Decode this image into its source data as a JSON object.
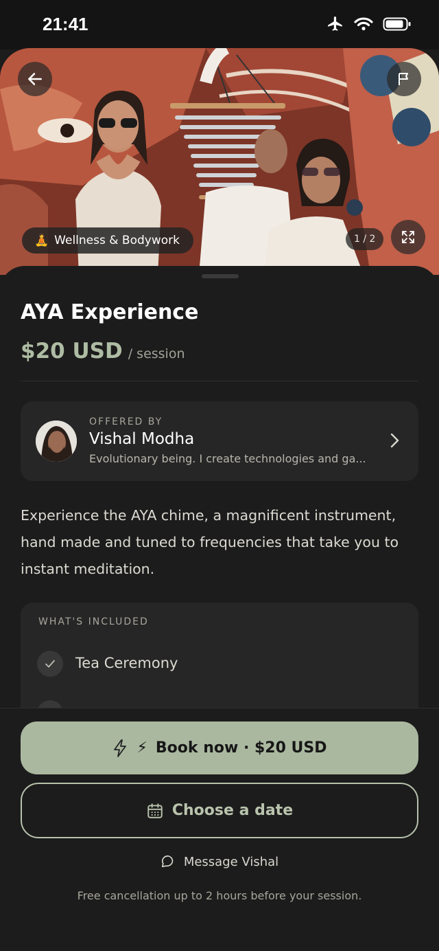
{
  "status_bar": {
    "time": "21:41",
    "icons": [
      "airplane-icon",
      "wifi-icon",
      "battery-icon"
    ]
  },
  "hero": {
    "category_chip": {
      "emoji": "🧘",
      "label": "Wellness & Bodywork"
    },
    "page_counter": "1 / 2",
    "icons": [
      "arrow-left-icon",
      "flag-icon",
      "expand-icon"
    ]
  },
  "listing": {
    "title": "AYA Experience",
    "price": "$20 USD",
    "price_unit": "/ session",
    "description": "Experience the AYA chime, a magnificent instrument, hand made and tuned to frequencies that take you to instant meditation."
  },
  "host": {
    "label": "OFFERED BY",
    "name": "Vishal Modha",
    "bio": "Evolutionary being. I create technologies and ga..."
  },
  "included": {
    "heading": "WHAT'S INCLUDED",
    "items": [
      "Tea Ceremony"
    ]
  },
  "footer": {
    "book_label": "Book now · $20 USD",
    "book_emoji": "⚡",
    "date_label": "Choose a date",
    "message_label": "Message Vishal",
    "cancel_note": "Free cancellation up to 2 hours before your session."
  },
  "colors": {
    "background": "#1c1c1c",
    "card": "#262626",
    "accent_sage": "#aab8a0",
    "price": "#aebca3"
  }
}
